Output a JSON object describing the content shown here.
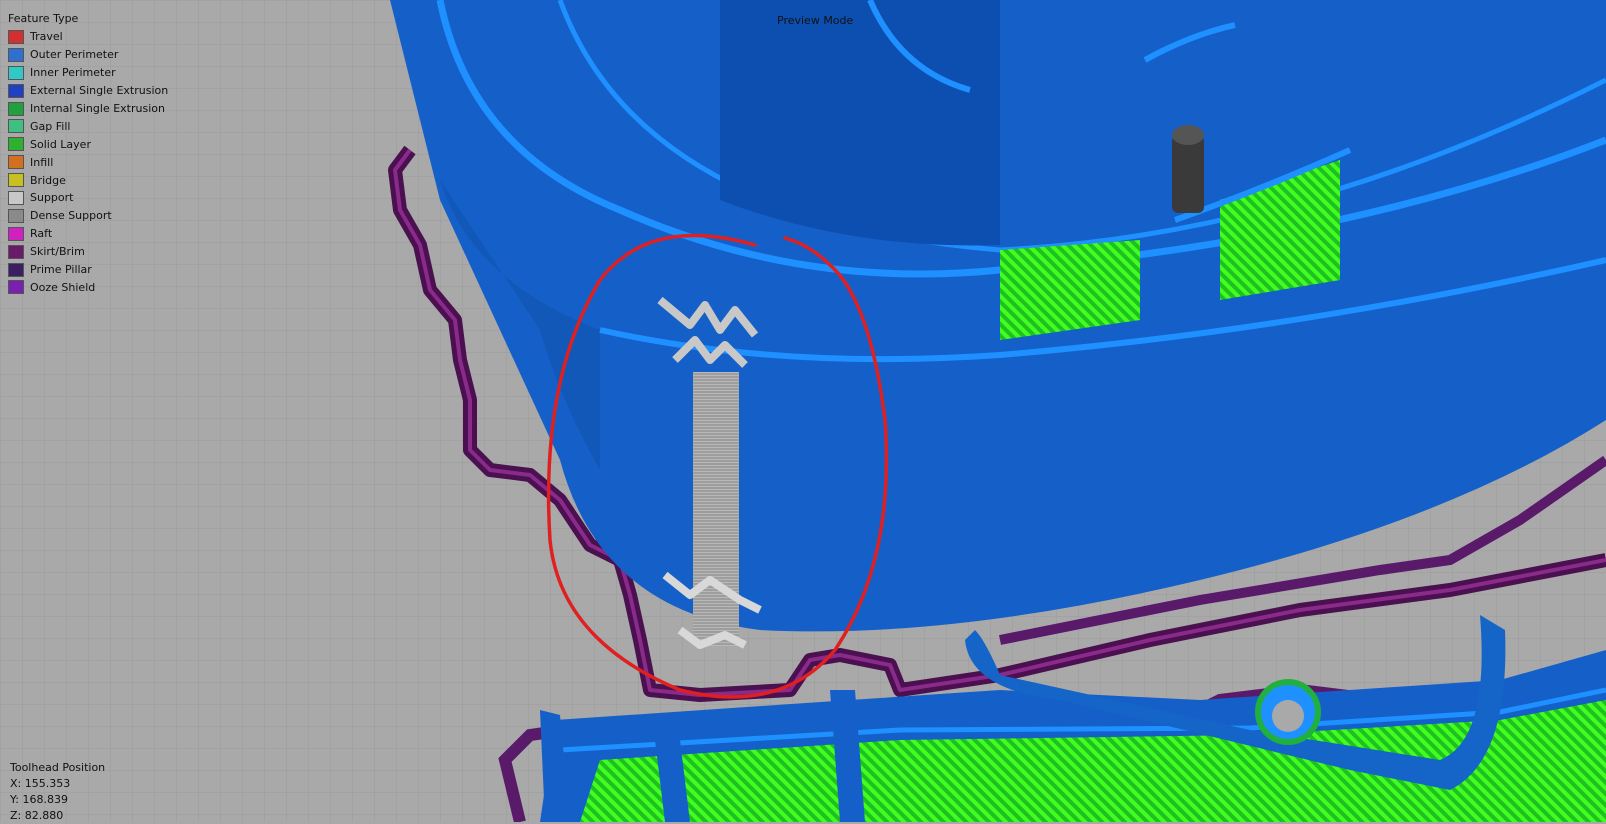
{
  "legend": {
    "title": "Feature Type",
    "items": [
      {
        "label": "Travel",
        "color": "#d03030"
      },
      {
        "label": "Outer Perimeter",
        "color": "#2f6fcf"
      },
      {
        "label": "Inner Perimeter",
        "color": "#32c8c8"
      },
      {
        "label": "External Single Extrusion",
        "color": "#2040c0"
      },
      {
        "label": "Internal Single Extrusion",
        "color": "#20a040"
      },
      {
        "label": "Gap Fill",
        "color": "#40c080"
      },
      {
        "label": "Solid Layer",
        "color": "#30b030"
      },
      {
        "label": "Infill",
        "color": "#d07020"
      },
      {
        "label": "Bridge",
        "color": "#c8c020"
      },
      {
        "label": "Support",
        "color": "#c8c8c8"
      },
      {
        "label": "Dense Support",
        "color": "#8a8a8a"
      },
      {
        "label": "Raft",
        "color": "#d020c0"
      },
      {
        "label": "Skirt/Brim",
        "color": "#6a1a6a"
      },
      {
        "label": "Prime Pillar",
        "color": "#3a2060"
      },
      {
        "label": "Ooze Shield",
        "color": "#7a20b0"
      }
    ]
  },
  "mode_label": "Preview Mode",
  "toolhead": {
    "title": "Toolhead Position",
    "x": "X: 155.353",
    "y": "Y: 168.839",
    "z": "Z: 82.880"
  },
  "scene_colors": {
    "grid_background": "#a9a9a9",
    "wall_blue": "#1560c8",
    "wall_dark_blue": "#0d4fb0",
    "perimeter_light_blue": "#1e90ff",
    "infill_green": "#33ff22",
    "skirt_purple": "#5a1a6a",
    "support_gray": "#a0a0a0",
    "annotation_red": "#e02020"
  }
}
